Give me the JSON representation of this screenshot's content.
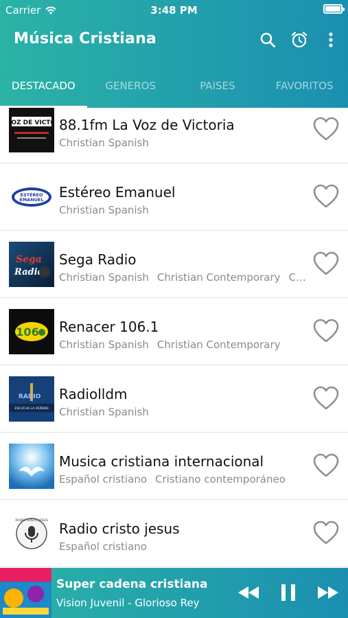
{
  "status_bar": {
    "carrier": "Carrier",
    "time": "3:48 PM"
  },
  "app_bar": {
    "title": "Música Cristiana"
  },
  "tabs": [
    {
      "label": "DESTACADO",
      "active": true
    },
    {
      "label": "GENEROS",
      "active": false
    },
    {
      "label": "PAISES",
      "active": false
    },
    {
      "label": "FAVORITOS",
      "active": false
    }
  ],
  "stations": [
    {
      "name": "88.1fm La Voz de Victoria",
      "genres": [
        "Christian Spanish"
      ],
      "logo_text": "LA VOZ DE VICTORIA",
      "favorite": false
    },
    {
      "name": "Estéreo Emanuel",
      "genres": [
        "Christian Spanish"
      ],
      "logo_text": "ESTEREO EMANUEL",
      "favorite": false
    },
    {
      "name": "Sega Radio",
      "genres": [
        "Christian Spanish",
        "Christian Contemporary",
        "C…"
      ],
      "logo_text": "Sega Radio",
      "favorite": false
    },
    {
      "name": "Renacer 106.1",
      "genres": [
        "Christian Spanish",
        "Christian Contemporary"
      ],
      "logo_text": "106",
      "favorite": false
    },
    {
      "name": "Radiolldm",
      "genres": [
        "Christian Spanish"
      ],
      "logo_text": "ESCUCHA LA VERDAD",
      "favorite": false
    },
    {
      "name": "Musica cristiana internacional",
      "genres": [
        "Español cristiano",
        "Cristiano contemporáneo"
      ],
      "logo_text": "",
      "favorite": false
    },
    {
      "name": "Radio cristo jesus",
      "genres": [
        "Español cristiano"
      ],
      "logo_text": "RADIO CRISTO JESUS",
      "favorite": false
    }
  ],
  "player": {
    "title": "Super cadena cristiana",
    "subtitle": "Vision Juvenil - Glorioso Rey"
  },
  "colors": {
    "accent_start": "#2bb3a6",
    "accent_end": "#1b8fb1",
    "heart": "#8f8f8f"
  }
}
